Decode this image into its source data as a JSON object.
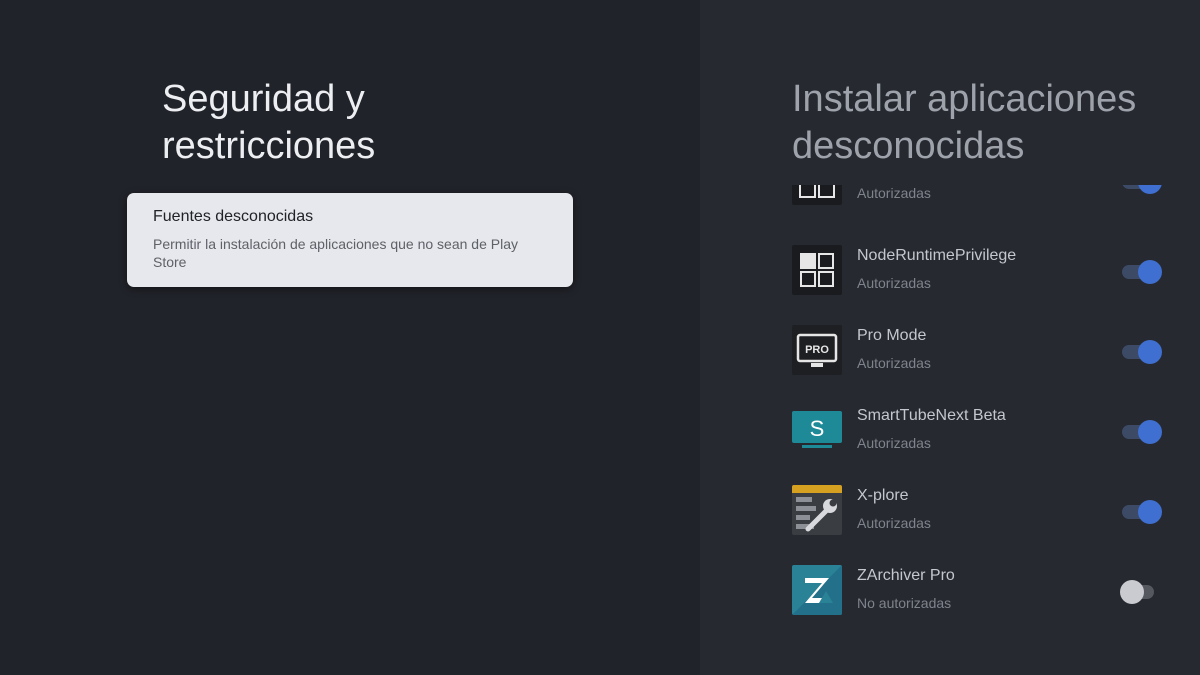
{
  "left": {
    "title_line1": "Seguridad y",
    "title_line2": "restricciones",
    "card": {
      "title": "Fuentes desconocidas",
      "description": "Permitir la instalación de aplicaciones que no sean de Play Store"
    }
  },
  "right": {
    "title_line1": "Instalar aplicaciones",
    "title_line2": "desconocidas",
    "apps": [
      {
        "name": "",
        "status": "Autorizadas",
        "icon": "grid-app-icon",
        "enabled": true
      },
      {
        "name": "NodeRuntimePrivilege",
        "status": "Autorizadas",
        "icon": "grid-app-icon",
        "enabled": true
      },
      {
        "name": "Pro Mode",
        "status": "Autorizadas",
        "icon": "pro-monitor-icon",
        "icon_text": "PRO",
        "enabled": true
      },
      {
        "name": "SmartTubeNext Beta",
        "status": "Autorizadas",
        "icon": "smarttube-icon",
        "icon_text": "S",
        "enabled": true
      },
      {
        "name": "X-plore",
        "status": "Autorizadas",
        "icon": "xplore-wrench-icon",
        "enabled": true
      },
      {
        "name": "ZArchiver Pro",
        "status": "No autorizadas",
        "icon": "zarchiver-icon",
        "enabled": false
      }
    ]
  },
  "colors": {
    "left_bg": "#21232a",
    "right_bg": "#262930",
    "card_bg": "#e7e8ed",
    "toggle_on": "#3f6fd0",
    "toggle_off": "#c9cbd0"
  }
}
